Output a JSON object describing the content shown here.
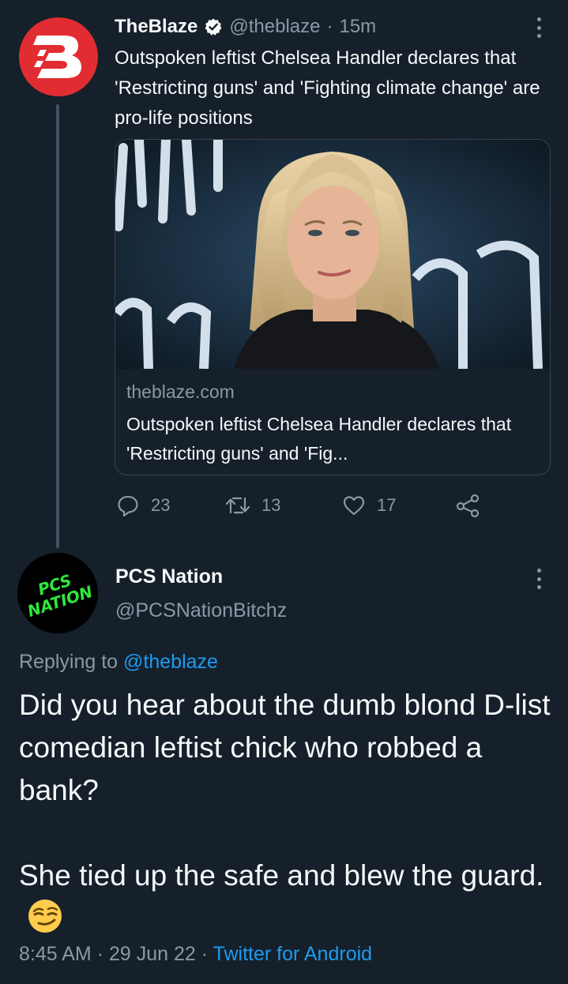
{
  "tweet": {
    "author_name": "TheBlaze",
    "handle": "@theblaze",
    "time": "15m",
    "text": "Outspoken leftist Chelsea Handler declares that 'Restricting guns' and 'Fighting climate change' are pro-life positions",
    "card": {
      "domain": "theblaze.com",
      "title": "Outspoken leftist Chelsea Handler declares that 'Restricting guns' and 'Fig..."
    },
    "stats": {
      "replies": "23",
      "retweets": "13",
      "likes": "17"
    }
  },
  "reply": {
    "author_name": "PCS Nation",
    "handle": "@PCSNationBitchz",
    "replying_prefix": "Replying to",
    "replying_to": "@theblaze",
    "text_line1": "Did you hear about the dumb blond D-list comedian leftist chick who robbed a bank?",
    "text_line2": "She tied up the safe and blew the guard.",
    "time": "8:45 AM",
    "date": "29 Jun 22",
    "source": "Twitter for Android",
    "avatar_text": "PCS NATION"
  },
  "colors": {
    "background": "#15202b",
    "text": "#f7f9f9",
    "secondary": "#8b98a5",
    "link": "#1d9bf0",
    "blaze_red": "#e12d32",
    "pcs_green": "#2ee83c"
  },
  "icons": [
    "blaze-logo-icon",
    "verified-badge-icon",
    "more-options-icon",
    "reply-icon",
    "retweet-icon",
    "like-icon",
    "share-icon",
    "smirking-face-emoji"
  ]
}
